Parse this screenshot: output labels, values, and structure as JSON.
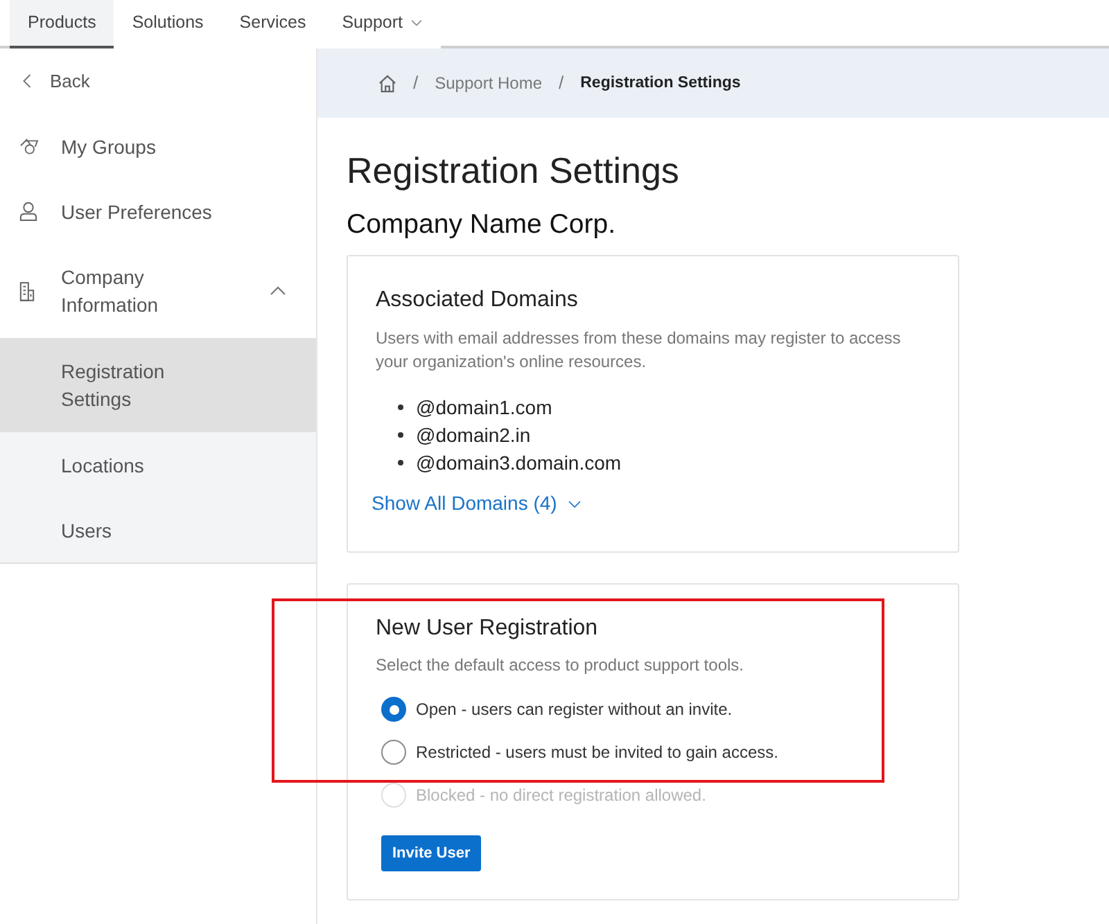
{
  "top_nav": {
    "tabs": [
      {
        "label": "Products",
        "selected": true,
        "dropdown": false
      },
      {
        "label": "Solutions",
        "selected": false,
        "dropdown": false
      },
      {
        "label": "Services",
        "selected": false,
        "dropdown": false
      },
      {
        "label": "Support",
        "selected": false,
        "dropdown": true
      }
    ]
  },
  "sidebar": {
    "back": "Back",
    "items": [
      {
        "label": "My Groups",
        "selected": false
      },
      {
        "label": "User Preferences",
        "selected": false
      },
      {
        "label": "Company Information",
        "selected": false,
        "expanded": true,
        "children": [
          {
            "label": "Registration Settings",
            "selected": true
          },
          {
            "label": "Locations",
            "selected": false
          },
          {
            "label": "Users",
            "selected": false
          }
        ]
      }
    ]
  },
  "breadcrumb": {
    "separator": "/",
    "items": [
      {
        "kind": "home"
      },
      {
        "kind": "link",
        "label": "Support Home"
      },
      {
        "kind": "current",
        "label": "Registration Settings"
      }
    ]
  },
  "page": {
    "title": "Registration Settings",
    "subtitle": "Company Name Corp."
  },
  "domains_card": {
    "title": "Associated Domains",
    "description": "Users with email addresses from these domains may register to access your organization's online resources.",
    "domains": [
      "@domain1.com",
      "@domain2.in",
      "@domain3.domain.com"
    ],
    "show_all": "Show All Domains (4)"
  },
  "registration_card": {
    "title": "New User Registration",
    "description": "Select the default access to product support tools.",
    "highlighted": true,
    "options": [
      {
        "label": "Open - users can register without an invite.",
        "selected": true,
        "disabled": false
      },
      {
        "label": "Restricted - users must be invited to gain access.",
        "selected": false,
        "disabled": false
      },
      {
        "label": "Blocked - no direct registration allowed.",
        "selected": false,
        "disabled": true
      }
    ],
    "button": "Invite User"
  }
}
